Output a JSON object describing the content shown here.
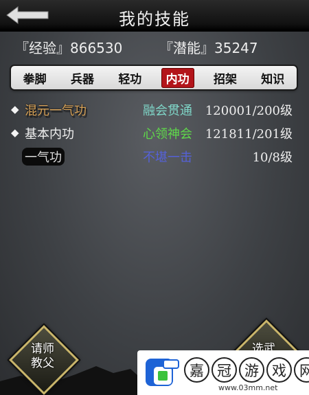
{
  "header": {
    "title": "我的技能",
    "back_icon": "back-arrow-icon"
  },
  "stats": {
    "experience": "『经验』866530",
    "potential": "『潜能』35247"
  },
  "tabs": [
    {
      "label": "拳脚",
      "active": false
    },
    {
      "label": "兵器",
      "active": false
    },
    {
      "label": "轻功",
      "active": false
    },
    {
      "label": "内功",
      "active": true
    },
    {
      "label": "招架",
      "active": false
    },
    {
      "label": "知识",
      "active": false
    }
  ],
  "skills": [
    {
      "name": "混元一气功",
      "level": "融会贯通",
      "value": "120001/200级",
      "marked": true
    },
    {
      "name": "基本内功",
      "level": "心领神会",
      "value": "121811/201级",
      "marked": true
    },
    {
      "name": "一气功",
      "level": "不堪一击",
      "value": "10/8级",
      "marked": false
    }
  ],
  "buttons": {
    "teacher_line1": "请师",
    "teacher_line2": "教父",
    "right_line1": "选武"
  },
  "watermark": {
    "chars": [
      "嘉",
      "冠",
      "游",
      "戏",
      "网"
    ],
    "url": "www.03mm.net"
  },
  "colors": {
    "active_tab": "#b3141a",
    "tabbar_bg": "#e8e8e8",
    "level_1": "#7fd6c8",
    "level_2": "#5fd94a",
    "level_3": "#5561d8",
    "skill_special": "#d9a45a"
  }
}
